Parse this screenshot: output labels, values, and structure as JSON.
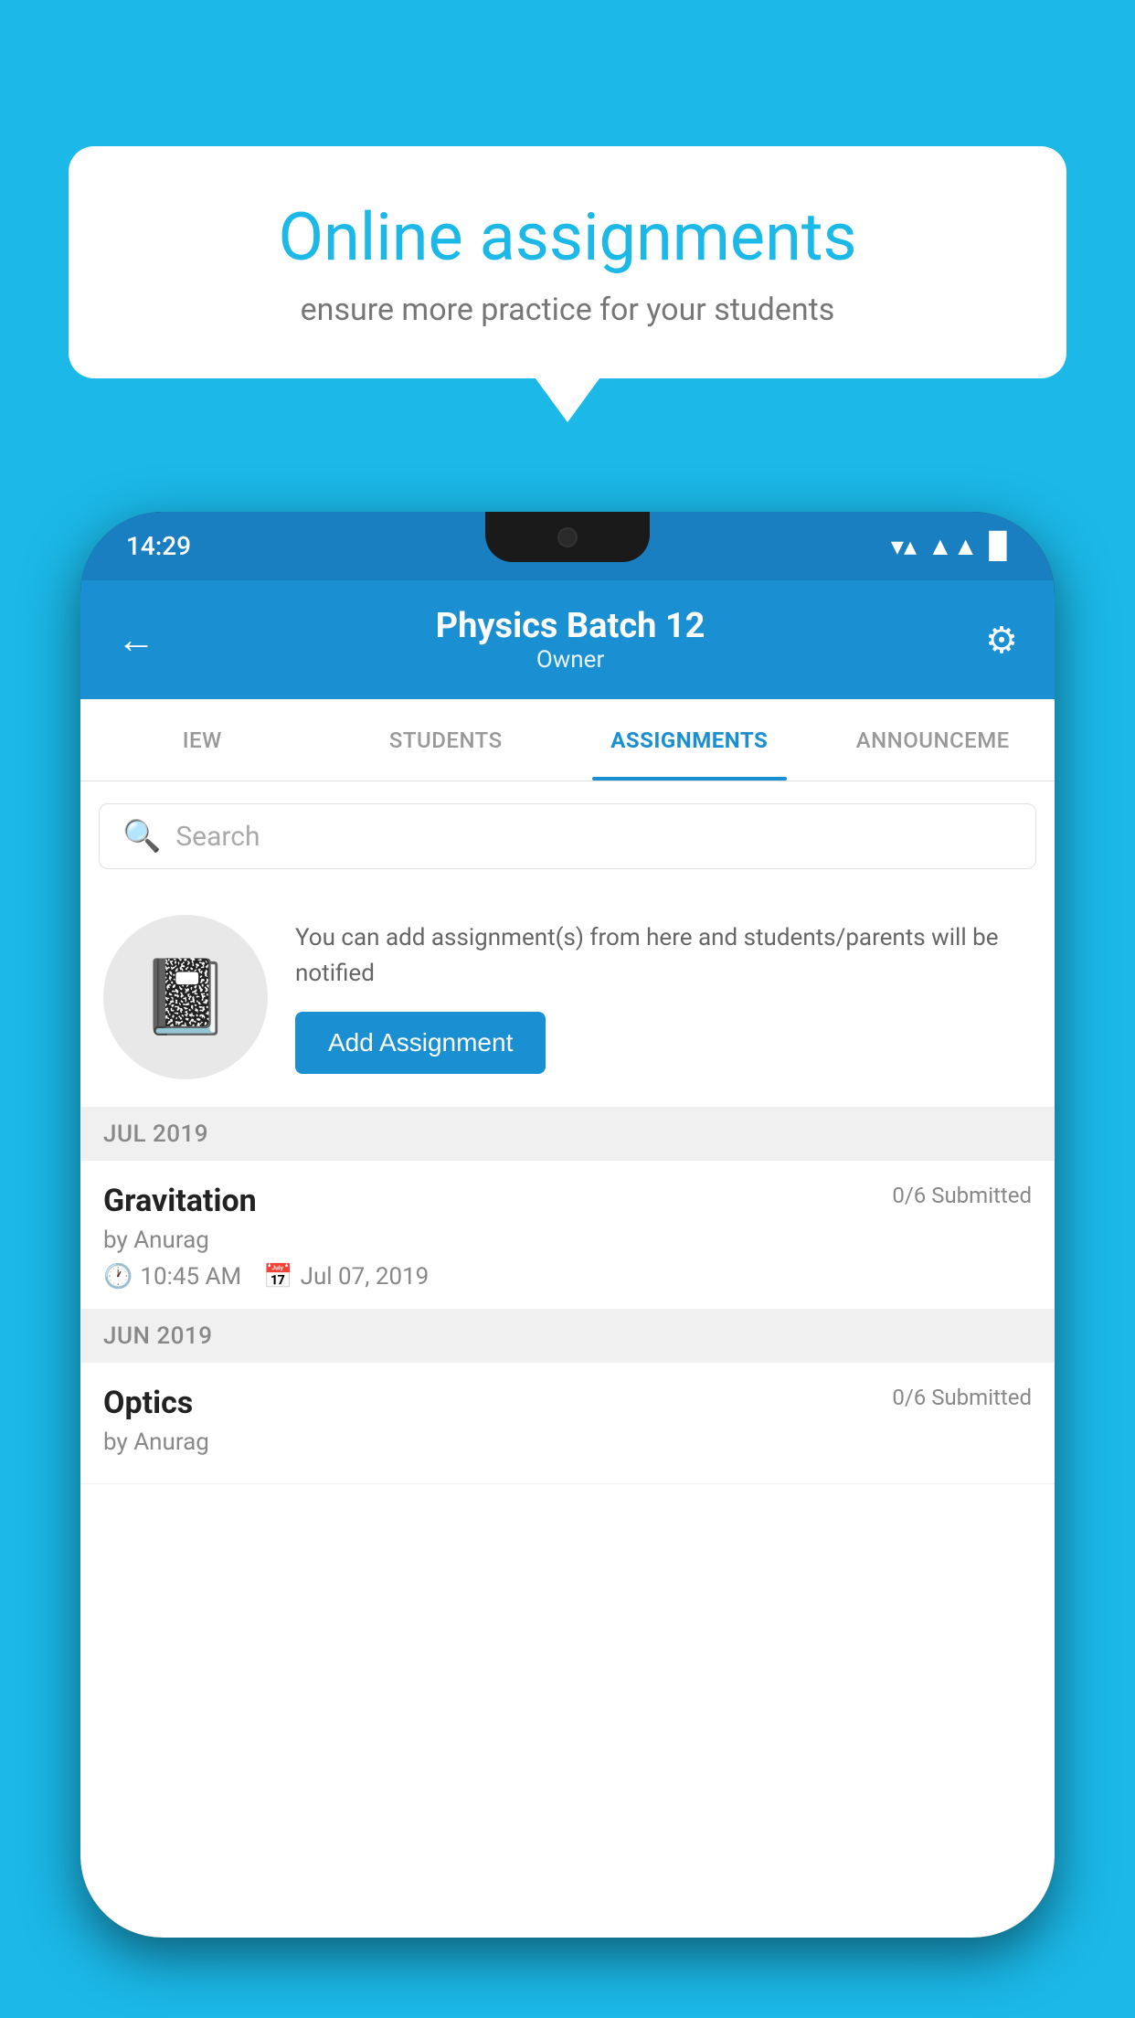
{
  "background_color": "#1BB8E8",
  "speech_bubble": {
    "title": "Online assignments",
    "subtitle": "ensure more practice for your students"
  },
  "phone": {
    "status_bar": {
      "time": "14:29",
      "wifi": "▲",
      "signal": "▲",
      "battery": "▊"
    },
    "header": {
      "title": "Physics Batch 12",
      "subtitle": "Owner",
      "back_label": "←",
      "settings_label": "⚙"
    },
    "tabs": [
      {
        "label": "IEW",
        "active": false
      },
      {
        "label": "STUDENTS",
        "active": false
      },
      {
        "label": "ASSIGNMENTS",
        "active": true
      },
      {
        "label": "ANNOUNCEME",
        "active": false
      }
    ],
    "search": {
      "placeholder": "Search"
    },
    "add_assignment": {
      "info_text": "You can add assignment(s) from here and students/parents will be notified",
      "button_label": "Add Assignment"
    },
    "sections": [
      {
        "month": "JUL 2019",
        "assignments": [
          {
            "name": "Gravitation",
            "submitted": "0/6 Submitted",
            "author": "by Anurag",
            "time": "10:45 AM",
            "date": "Jul 07, 2019"
          }
        ]
      },
      {
        "month": "JUN 2019",
        "assignments": [
          {
            "name": "Optics",
            "submitted": "0/6 Submitted",
            "author": "by Anurag",
            "time": "",
            "date": ""
          }
        ]
      }
    ]
  }
}
